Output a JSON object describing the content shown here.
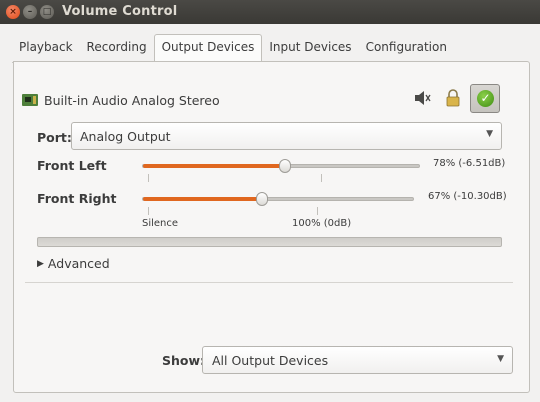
{
  "window": {
    "title": "Volume Control",
    "close_glyph": "×",
    "minimize_glyph": "–",
    "maximize_glyph": "□"
  },
  "tabs": [
    {
      "label": "Playback",
      "active": false
    },
    {
      "label": "Recording",
      "active": false
    },
    {
      "label": "Output Devices",
      "active": true
    },
    {
      "label": "Input Devices",
      "active": false
    },
    {
      "label": "Configuration",
      "active": false
    }
  ],
  "device": {
    "name": "Built-in Audio Analog Stereo",
    "icon": "sound-card-icon",
    "mute_icon": "speaker-mute-icon",
    "lock_icon": "lock-icon",
    "fallback_icon": "checkmark-icon",
    "fallback_active": true
  },
  "port": {
    "label": "Port:",
    "value": "Analog Output"
  },
  "channels": [
    {
      "name": "Front Left",
      "percent": 78,
      "value_text": "78% (-6.51dB)"
    },
    {
      "name": "Front Right",
      "percent": 67,
      "value_text": "67% (-10.30dB)"
    }
  ],
  "scale": {
    "silence_label": "Silence",
    "full_label": "100% (0dB)"
  },
  "advanced_label": "Advanced",
  "show": {
    "label": "Show:",
    "value": "All Output Devices"
  },
  "colors": {
    "accent": "#e0671f",
    "titlebar": "#3c3b37",
    "close_button": "#e6531f"
  }
}
